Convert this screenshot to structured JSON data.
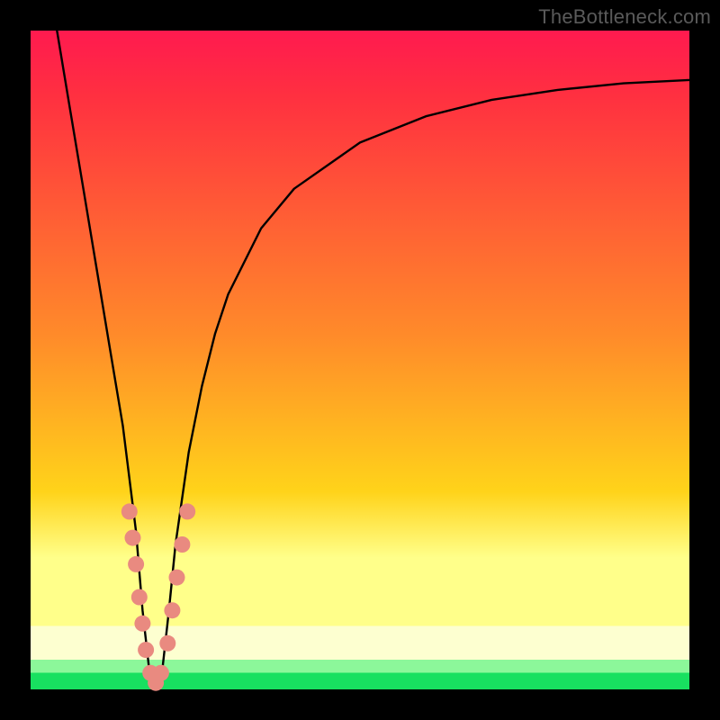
{
  "watermark": "TheBottleneck.com",
  "colors": {
    "top": "#ff1a4f",
    "red": "#ff3040",
    "orange": "#ff8a2a",
    "yellow": "#ffd31a",
    "paleyellow": "#ffff8a",
    "cream": "#fdffd0",
    "lightgreen": "#8cf79a",
    "green": "#18e060",
    "curve": "#000000",
    "marker": "#e98a80",
    "marker_stroke": "#9b4a42"
  },
  "chart_data": {
    "type": "line",
    "title": "",
    "xlabel": "",
    "ylabel": "",
    "xlim": [
      0,
      100
    ],
    "ylim": [
      0,
      100
    ],
    "series": [
      {
        "name": "bottleneck-curve",
        "x": [
          4,
          6,
          8,
          10,
          12,
          14,
          16,
          17,
          18,
          19,
          20,
          21,
          22,
          24,
          26,
          28,
          30,
          35,
          40,
          50,
          60,
          70,
          80,
          90,
          100
        ],
        "y": [
          100,
          88,
          76,
          64,
          52,
          40,
          24,
          12,
          3,
          0,
          3,
          12,
          22,
          36,
          46,
          54,
          60,
          70,
          76,
          83,
          87,
          89.5,
          91,
          92,
          92.5
        ]
      }
    ],
    "markers": [
      {
        "x": 15.0,
        "y": 27
      },
      {
        "x": 15.5,
        "y": 23
      },
      {
        "x": 16.0,
        "y": 19
      },
      {
        "x": 16.5,
        "y": 14
      },
      {
        "x": 17.0,
        "y": 10
      },
      {
        "x": 17.5,
        "y": 6
      },
      {
        "x": 18.2,
        "y": 2.5
      },
      {
        "x": 19.0,
        "y": 1
      },
      {
        "x": 19.8,
        "y": 2.5
      },
      {
        "x": 20.8,
        "y": 7
      },
      {
        "x": 21.5,
        "y": 12
      },
      {
        "x": 22.2,
        "y": 17
      },
      {
        "x": 23.0,
        "y": 22
      },
      {
        "x": 23.8,
        "y": 27
      }
    ]
  }
}
